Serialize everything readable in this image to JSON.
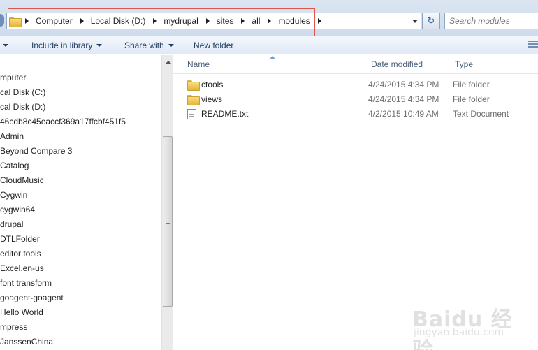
{
  "address_bar": {
    "crumbs": [
      "Computer",
      "Local Disk (D:)",
      "mydrupal",
      "sites",
      "all",
      "modules"
    ],
    "search_placeholder": "Search modules"
  },
  "toolbar": {
    "include_label": "Include in library",
    "share_label": "Share with",
    "new_folder_label": "New folder"
  },
  "nav_pane": {
    "items": [
      "mputer",
      "cal Disk (C:)",
      "cal Disk (D:)",
      "46cdb8c45eaccf369a17ffcbf451f5",
      "Admin",
      "Beyond Compare 3",
      "Catalog",
      "CloudMusic",
      "Cygwin",
      "cygwin64",
      "drupal",
      "DTLFolder",
      "editor tools",
      "Excel.en-us",
      "font transform",
      "goagent-goagent",
      "Hello World",
      "mpress",
      "JanssenChina"
    ]
  },
  "columns": {
    "name": "Name",
    "date": "Date modified",
    "type": "Type"
  },
  "files": [
    {
      "name": "ctools",
      "date": "4/24/2015 4:34 PM",
      "type": "File folder",
      "icon": "folder-icon"
    },
    {
      "name": "views",
      "date": "4/24/2015 4:34 PM",
      "type": "File folder",
      "icon": "folder-icon"
    },
    {
      "name": "README.txt",
      "date": "4/2/2015 10:49 AM",
      "type": "Text Document",
      "icon": "text-document-icon"
    }
  ],
  "watermark": {
    "logo": "Baidu 经验",
    "url": "jingyan.baidu.com"
  }
}
